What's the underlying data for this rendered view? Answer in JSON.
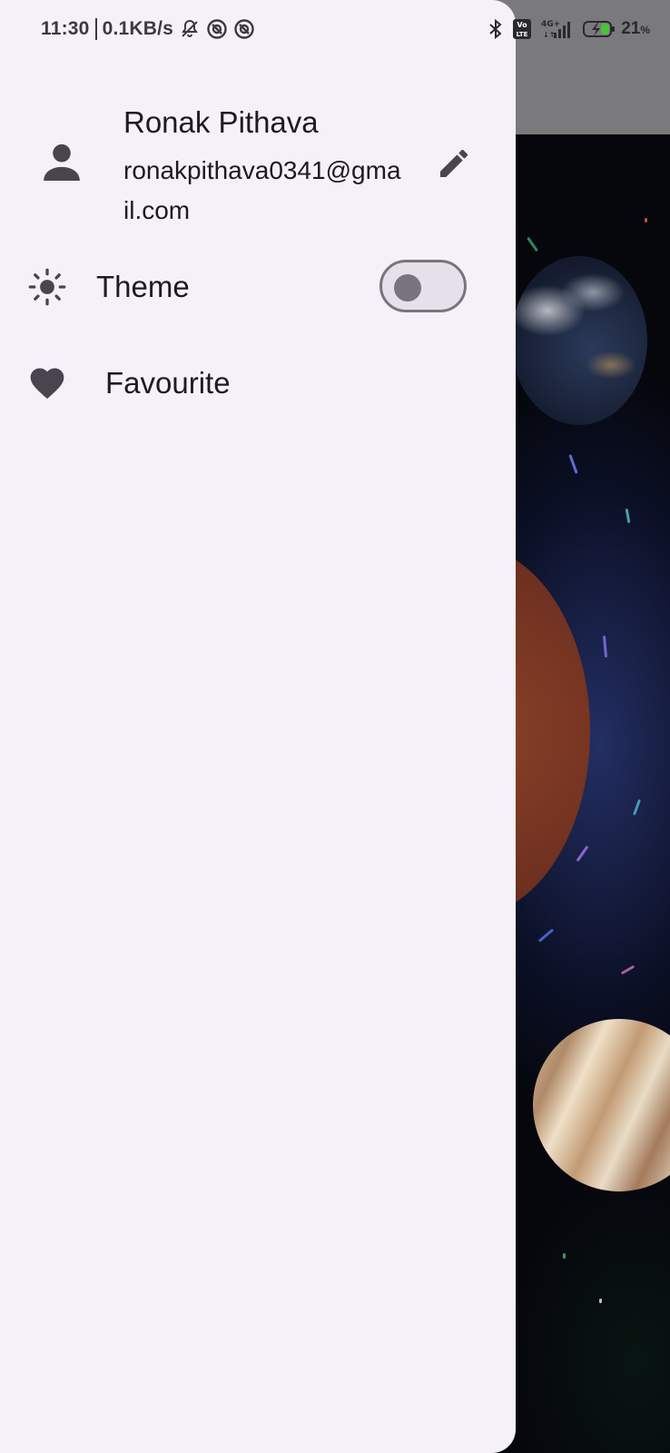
{
  "status_bar": {
    "time": "11:30",
    "net_speed": "0.1KB/s",
    "battery_percent": "21",
    "battery_unit": "%",
    "icons": [
      "mute-bell-icon",
      "sync-icon",
      "sync-icon",
      "bluetooth-icon",
      "volte-icon",
      "signal-4g-icon",
      "battery-charging-icon"
    ]
  },
  "drawer": {
    "profile": {
      "name": "Ronak Pithava",
      "email": "ronakpithava0341@gmail.com",
      "avatar_icon": "person-icon",
      "edit_icon": "pencil-icon"
    },
    "items": [
      {
        "label": "Theme",
        "icon": "sun-icon",
        "control": "switch",
        "switch_on": false
      },
      {
        "label": "Favourite",
        "icon": "heart-icon"
      }
    ]
  },
  "colors": {
    "drawer_bg": "#f6f1f8",
    "text": "#1d1b20",
    "icon": "#49454f",
    "switch_outline": "#79747e",
    "switch_track": "#e6e0ea"
  }
}
